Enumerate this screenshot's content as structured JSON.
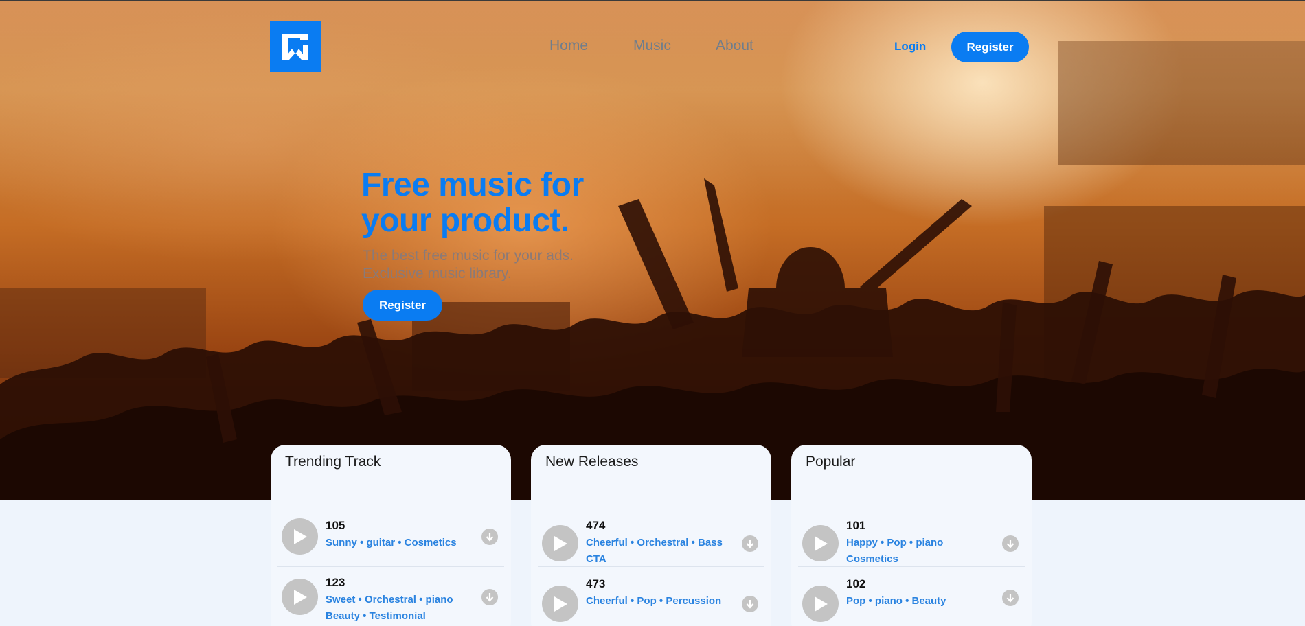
{
  "nav": {
    "logo_icon": "brand-logo",
    "links": [
      "Home",
      "Music",
      "About"
    ],
    "login": "Login",
    "register": "Register"
  },
  "hero": {
    "title": "Free music for your product.",
    "subtitle_line1": "The best free music for your ads.",
    "subtitle_line2": "Exclusive music library.",
    "cta": "Register"
  },
  "cards": [
    {
      "title": "Trending Track",
      "tracks": [
        {
          "number": "105",
          "tags_line1": "Sunny • guitar • Cosmetics",
          "tags_line2": ""
        },
        {
          "number": "123",
          "tags_line1": "Sweet • Orchestral • piano",
          "tags_line2": "Beauty • Testimonial"
        }
      ]
    },
    {
      "title": "New Releases",
      "tracks": [
        {
          "number": "474",
          "tags_line1": "Cheerful • Orchestral • Bass",
          "tags_line2": "CTA"
        },
        {
          "number": "473",
          "tags_line1": "Cheerful • Pop • Percussion",
          "tags_line2": ""
        }
      ]
    },
    {
      "title": "Popular",
      "tracks": [
        {
          "number": "101",
          "tags_line1": "Happy • Pop • piano",
          "tags_line2": "Cosmetics"
        },
        {
          "number": "102",
          "tags_line1": "Pop • piano • Beauty",
          "tags_line2": ""
        }
      ]
    }
  ],
  "colors": {
    "accent": "#0a7cf2",
    "tag": "#2a83e0",
    "card_bg": "#f3f7fd",
    "page_bg": "#eef4fc"
  }
}
